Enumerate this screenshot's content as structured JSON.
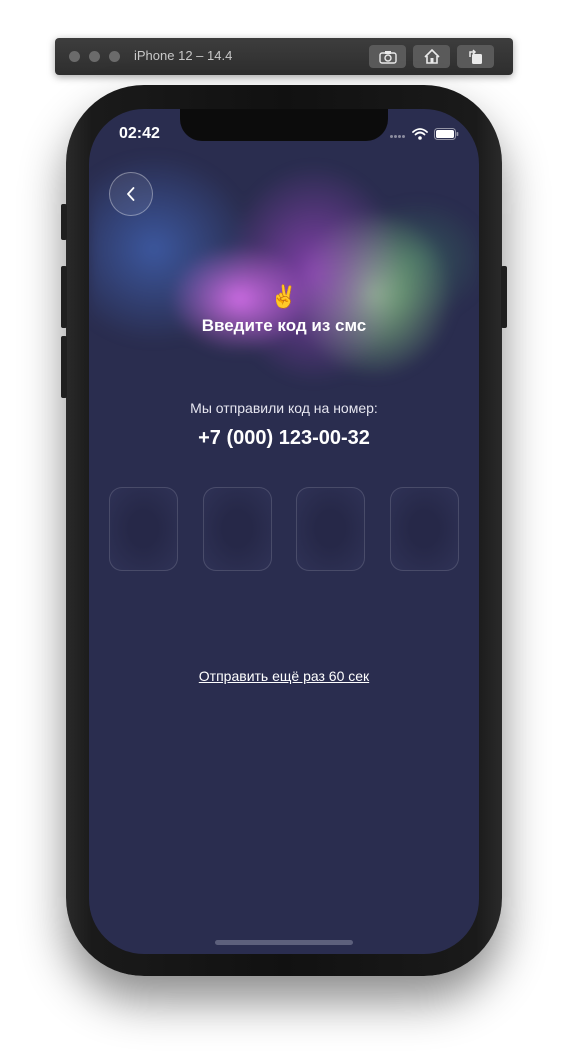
{
  "simulator": {
    "title": "iPhone 12 – 14.4",
    "buttons": [
      "screenshot-icon",
      "home-icon",
      "rotate-icon"
    ]
  },
  "status_bar": {
    "time": "02:42",
    "icons": [
      "signal-icon",
      "wifi-icon",
      "battery-icon"
    ]
  },
  "header": {
    "back_icon": "chevron-left-icon"
  },
  "main": {
    "emoji": "✌️",
    "title": "Введите код из смс",
    "subtitle": "Мы отправили код на номер:",
    "phone": "+7 (000) 123-00-32",
    "code_digits": [
      "",
      "",
      "",
      ""
    ],
    "resend_label": "Отправить ещё раз 60 сек"
  },
  "colors": {
    "background": "#2a2d4f",
    "text": "#ffffff"
  }
}
